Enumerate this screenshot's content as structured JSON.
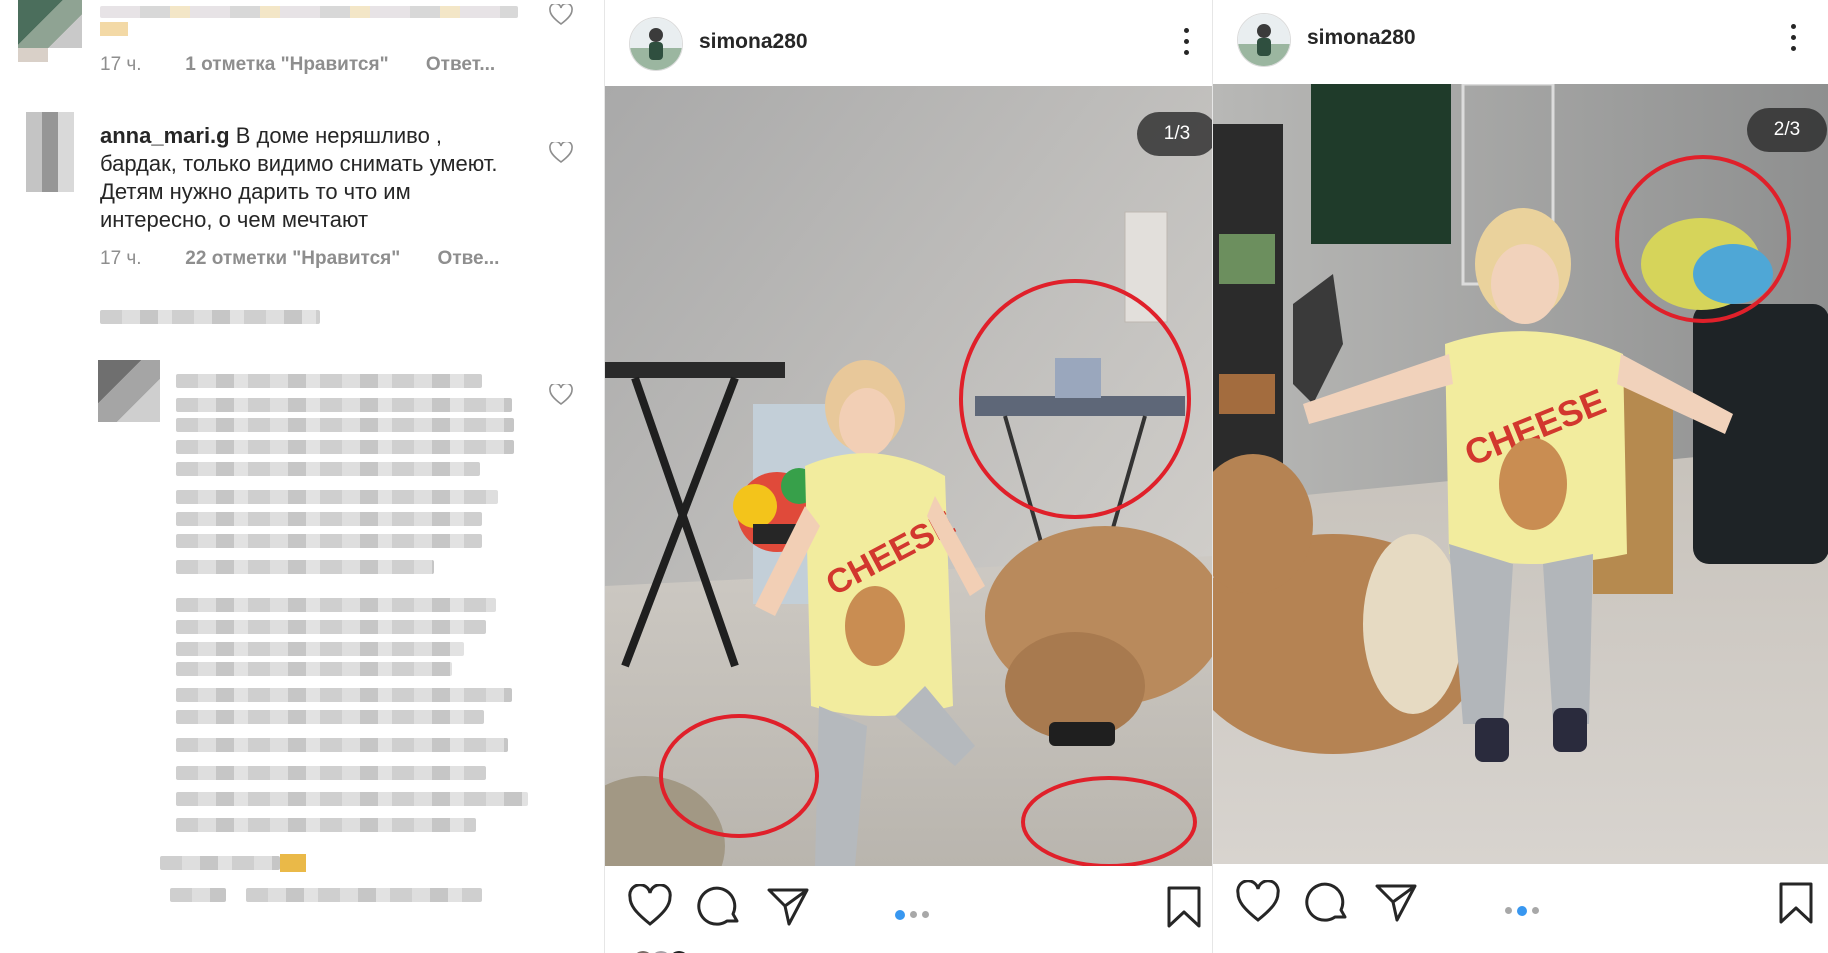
{
  "comments": {
    "item1": {
      "time": "17 ч.",
      "likes": "1 отметка \"Нравится\"",
      "reply": "Ответ..."
    },
    "item2": {
      "username": "anna_mari.g",
      "text": "В доме неряшливо , бардак, только видимо снимать умеют. Детям нужно дарить то что им интересно, о чем мечтают",
      "time": "17 ч.",
      "likes": "22 отметки \"Нравится\"",
      "reply": "Отве..."
    }
  },
  "posts": [
    {
      "username": "simona280",
      "counter": "1/3",
      "carousel_active_index": 0,
      "carousel_count": 3
    },
    {
      "username": "simona280",
      "counter": "2/3",
      "carousel_active_index": 1,
      "carousel_count": 3
    }
  ],
  "shirt_text": "CHEESE",
  "icons": [
    "heart-icon",
    "comment-icon",
    "share-icon",
    "bookmark-icon",
    "more-options-icon"
  ],
  "colors": {
    "highlight_circle": "#e0202a",
    "active_dot": "#3897f0",
    "text": "#262626",
    "muted": "#8e8e8e"
  }
}
